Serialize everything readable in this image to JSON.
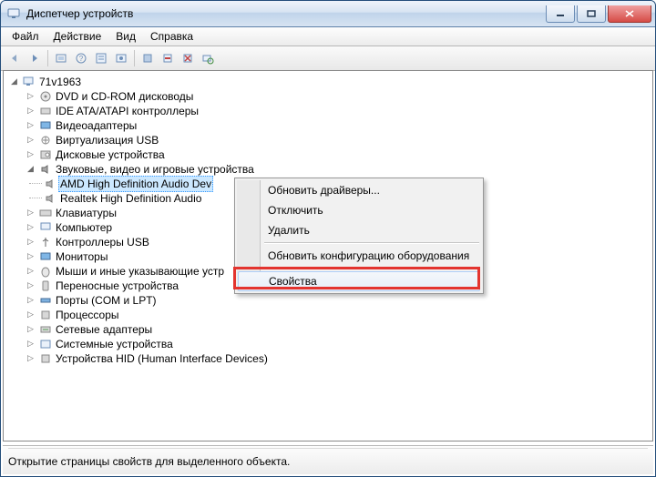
{
  "window": {
    "title": "Диспетчер устройств"
  },
  "menubar": {
    "file": "Файл",
    "action": "Действие",
    "view": "Вид",
    "help": "Справка"
  },
  "tree": {
    "root": "71v1963",
    "items": [
      "DVD и CD-ROM дисководы",
      "IDE ATA/ATAPI контроллеры",
      "Видеоадаптеры",
      "Виртуализация USB",
      "Дисковые устройства"
    ],
    "audio_header": "Звуковые, видео и игровые устройства",
    "audio_children": [
      "AMD High Definition Audio Dev",
      "Realtek High Definition Audio"
    ],
    "items_after": [
      "Клавиатуры",
      "Компьютер",
      "Контроллеры USB",
      "Мониторы",
      "Мыши и иные указывающие устр",
      "Переносные устройства",
      "Порты (COM и LPT)",
      "Процессоры",
      "Сетевые адаптеры",
      "Системные устройства",
      "Устройства HID (Human Interface Devices)"
    ]
  },
  "context_menu": {
    "update": "Обновить драйверы...",
    "disable": "Отключить",
    "delete": "Удалить",
    "scan": "Обновить конфигурацию оборудования",
    "properties": "Свойства"
  },
  "statusbar": {
    "text": "Открытие страницы свойств для выделенного объекта."
  }
}
